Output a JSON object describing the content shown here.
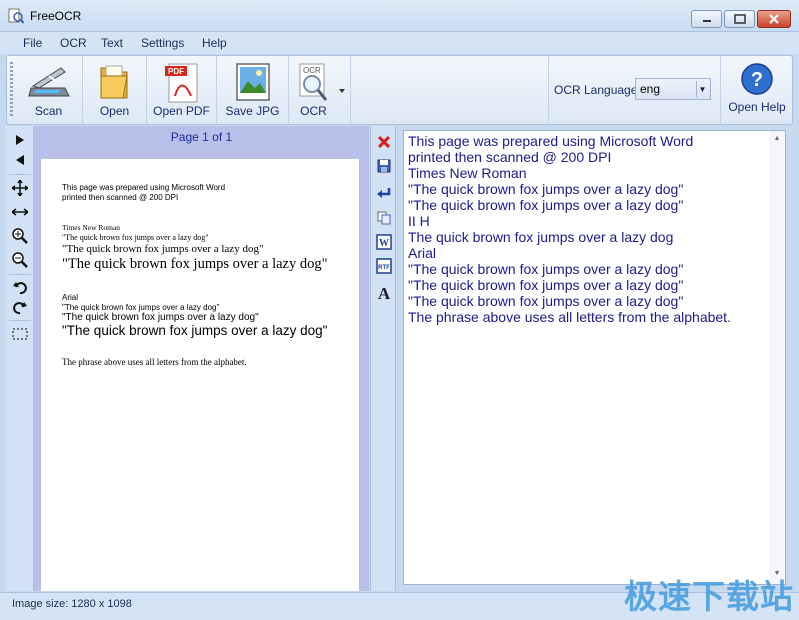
{
  "window": {
    "title": "FreeOCR"
  },
  "menu": [
    "File",
    "OCR",
    "Text",
    "Settings",
    "Help"
  ],
  "toolbar": {
    "scan": "Scan",
    "open": "Open",
    "open_pdf": "Open PDF",
    "pdf_badge": "PDF",
    "save_jpg": "Save JPG",
    "ocr": "OCR",
    "ocr_badge": "OCR",
    "ocr_language_label": "OCR Language:",
    "ocr_language_value": "eng",
    "open_help": "Open Help"
  },
  "preview": {
    "page_counter": "Page 1 of 1",
    "lines": [
      "This page was prepared using Microsoft Word",
      "printed then scanned @ 200 DPI",
      "Times New Roman",
      "\"The quick brown fox jumps over a lazy dog\"",
      "\"The quick brown fox jumps over a lazy dog\"",
      "\"The quick brown fox jumps over a lazy dog\"",
      "Arial",
      "\"The quick brown fox jumps over a lazy dog\"",
      "\"The quick brown fox  jumps over a lazy dog\"",
      "\"The quick brown fox jumps over a lazy dog\"",
      "The phrase above uses all letters from the alphabet."
    ]
  },
  "ocr_text": [
    "This page was prepared using Microsoft Word",
    "printed then scanned @ 200 DPI",
    "Times New Roman",
    "\"The quick brown fox jumps over a lazy dog\"",
    "\"The quick brown fox jumps over a lazy dog\"",
    "II H",
    "The quick brown fox jumps over a lazy dog",
    "Arial",
    "\"The quick brown fox jumps over a lazy dog\"",
    "\"The quick brown fox jumps over a lazy dog\"",
    "\"The quick brown fox jumps over a lazy dog\"",
    "The phrase above uses all letters from the alphabet."
  ],
  "status": {
    "image_size": "Image size:  1280 x 1098"
  },
  "watermark": "极速下载站",
  "colors": {
    "text_blue": "#1b1b8c",
    "panel_lavender": "#b8bfe8",
    "watermark": "#4a9fe0"
  }
}
